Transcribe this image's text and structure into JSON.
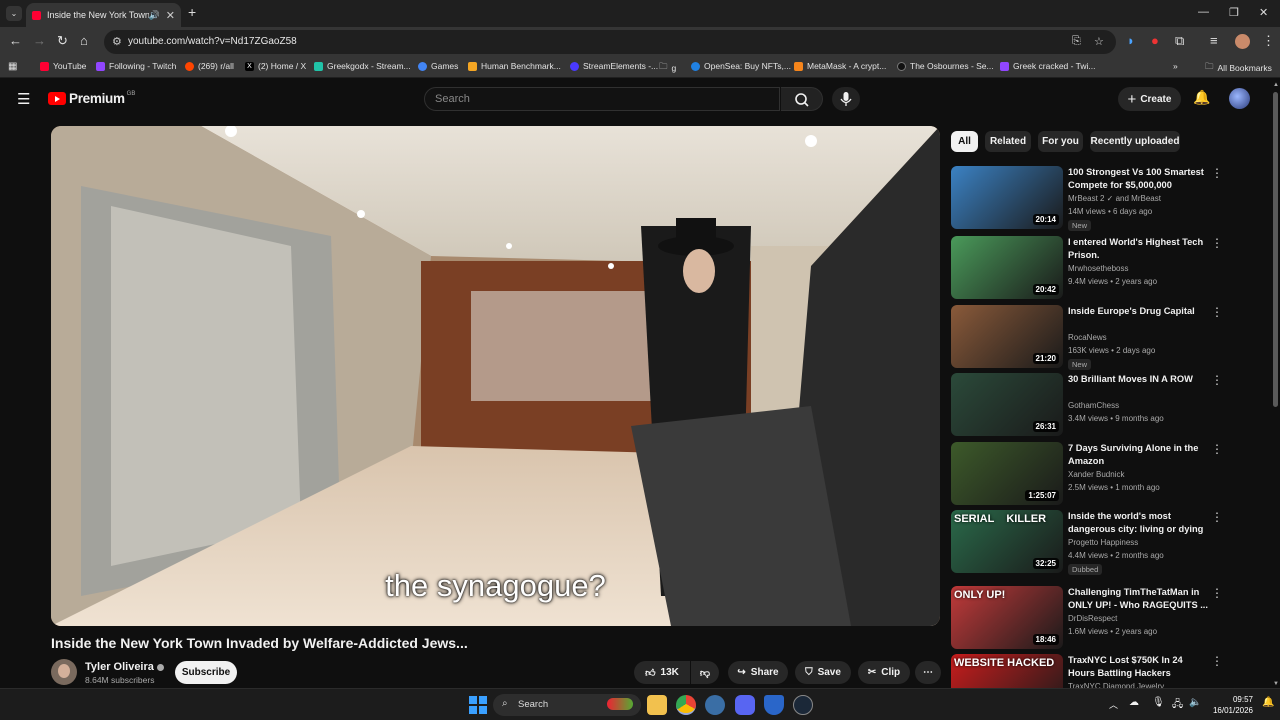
{
  "browser": {
    "tab_title": "Inside the New York Town I",
    "url": "youtube.com/watch?v=Nd17ZGaoZ58",
    "bookmarks": [
      {
        "label": "YouTube",
        "color": "#ff0033"
      },
      {
        "label": "Following - Twitch",
        "color": "#9146ff"
      },
      {
        "label": "(269) r/all",
        "color": "#ff4500"
      },
      {
        "label": "(2) Home / X",
        "color": "#000000"
      },
      {
        "label": "Greekgodx - Stream...",
        "color": "#21c3a8"
      },
      {
        "label": "Games",
        "color": "#4285f4"
      },
      {
        "label": "Human Benchmark...",
        "color": "#f5a623"
      },
      {
        "label": "StreamElements -...",
        "color": "#4a3aff"
      },
      {
        "label": "g",
        "color": "#353535"
      },
      {
        "label": "OpenSea: Buy NFTs,...",
        "color": "#2081e2"
      },
      {
        "label": "MetaMask - A crypt...",
        "color": "#f6851b"
      },
      {
        "label": "The Osbournes - Se...",
        "color": "#222222"
      },
      {
        "label": "Greek cracked - Twi...",
        "color": "#9146ff"
      }
    ],
    "all_bookmarks": "All Bookmarks"
  },
  "youtube": {
    "logo_text": "Premium",
    "country": "GB",
    "search_placeholder": "Search",
    "create_label": "Create"
  },
  "video": {
    "subtitle": "the synagogue?",
    "title": "Inside the New York Town Invaded by Welfare-Addicted Jews...",
    "channel": "Tyler Oliveira",
    "subscribers": "8.64M subscribers",
    "subscribe_label": "Subscribe",
    "likes": "13K",
    "share_label": "Share",
    "save_label": "Save",
    "clip_label": "Clip"
  },
  "chips": [
    "All",
    "Related",
    "For you",
    "Recently uploaded"
  ],
  "recommendations": [
    {
      "title": "100 Strongest Vs 100 Smartest Compete for $5,000,000",
      "channel": "MrBeast 2 ✓ and MrBeast",
      "stats": "14M views • 6 days ago",
      "duration": "20:14",
      "badge": "New",
      "thumb": "#3b82c4"
    },
    {
      "title": "I entered World's Highest Tech Prison.",
      "channel": "Mrwhosetheboss",
      "stats": "9.4M views • 2 years ago",
      "duration": "20:42",
      "badge": "",
      "thumb": "#4a9a5a"
    },
    {
      "title": "Inside Europe's Drug Capital",
      "channel": "RocaNews",
      "stats": "163K views • 2 days ago",
      "duration": "21:20",
      "badge": "New",
      "thumb": "#8a5a3a"
    },
    {
      "title": "30 Brilliant Moves IN A ROW",
      "channel": "GothamChess",
      "stats": "3.4M views • 9 months ago",
      "duration": "26:31",
      "badge": "",
      "thumb": "#2b4a3a"
    },
    {
      "title": "7 Days Surviving Alone in the Amazon",
      "channel": "Xander Budnick",
      "stats": "2.5M views • 1 month ago",
      "duration": "1:25:07",
      "badge": "",
      "thumb": "#3d5a2a"
    },
    {
      "title": "Inside the world's most dangerous city: living or dying ...",
      "channel": "Progetto Happiness",
      "stats": "4.4M views • 2 months ago",
      "duration": "32:25",
      "badge": "Dubbed",
      "thumb": "#2a6a4a",
      "overlay": "SERIAL    KILLER"
    },
    {
      "title": "Challenging TimTheTatMan in ONLY UP! - Who RAGEQUITS ...",
      "channel": "DrDisRespect",
      "stats": "1.6M views • 2 years ago",
      "duration": "18:46",
      "badge": "",
      "thumb": "#c23a3a",
      "overlay": "ONLY UP!"
    },
    {
      "title": "TraxNYC Lost $750K In 24 Hours Battling Hackers",
      "channel": "TraxNYC Diamond Jewelry",
      "stats": "",
      "duration": "",
      "badge": "",
      "thumb": "#c81d1d",
      "overlay": "WEBSITE HACKED"
    }
  ],
  "taskbar": {
    "search_label": "Search",
    "time": "09:57",
    "date": "16/01/2026"
  }
}
